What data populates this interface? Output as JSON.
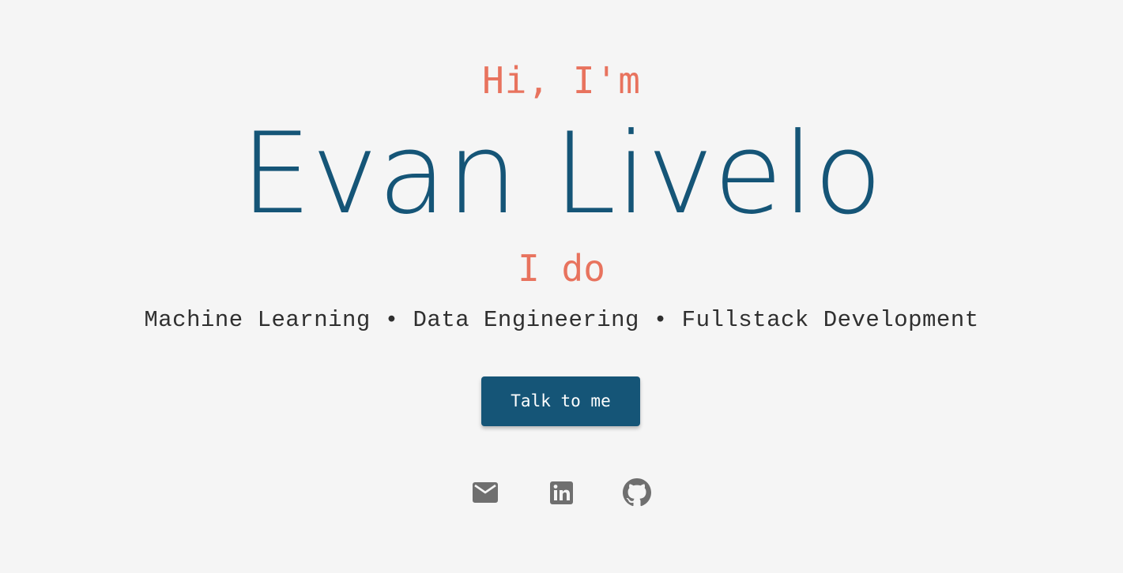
{
  "hero": {
    "greeting": "Hi, I'm",
    "name": "Evan Livelo",
    "intro": "I do",
    "skills": "Machine Learning • Data Engineering • Fullstack Development"
  },
  "cta": {
    "label": "Talk to me"
  },
  "social": {
    "icons": [
      "mail-icon",
      "linkedin-icon",
      "github-icon"
    ],
    "icon_color": "#6f6f6f"
  },
  "colors": {
    "background": "#f5f5f5",
    "accent": "#e8735e",
    "primary": "#155577",
    "text": "#2f2f2f"
  }
}
